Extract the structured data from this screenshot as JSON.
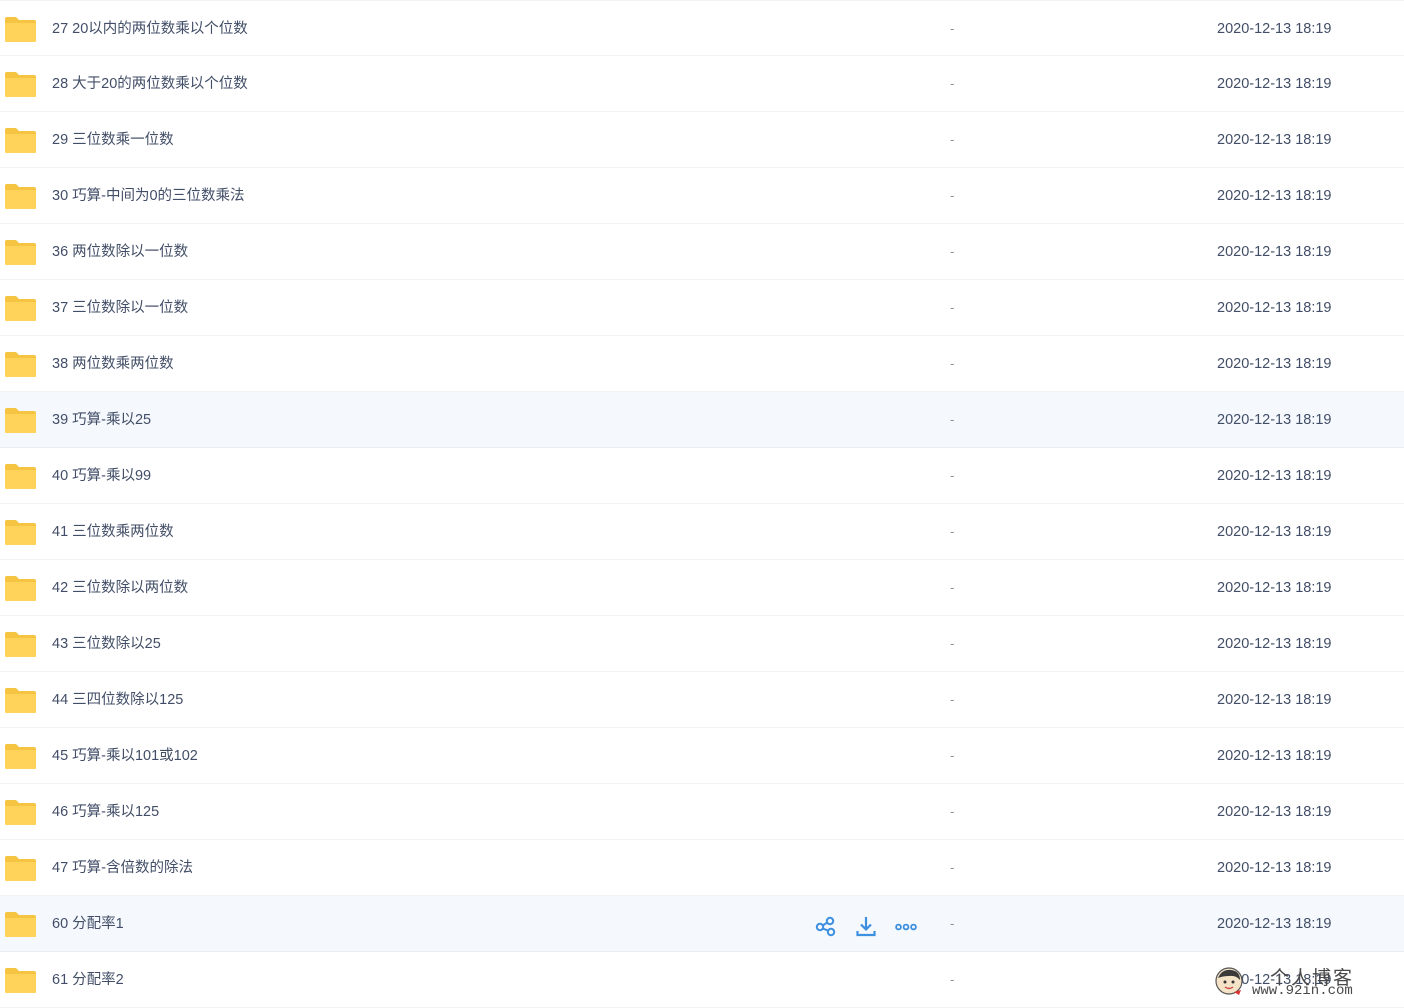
{
  "colors": {
    "folder": "#ffd35a",
    "folder_tab": "#f5c443",
    "action_icon": "#3d8fe0",
    "row_hover": "#f5f9fd",
    "text": "#424e67"
  },
  "icons": {
    "folder": "folder-icon",
    "share": "share-icon",
    "download": "download-icon",
    "more": "more-icon"
  },
  "files": [
    {
      "name": "27 20以内的两位数乘以个位数",
      "size": "-",
      "date": "2020-12-13 18:19"
    },
    {
      "name": "28 大于20的两位数乘以个位数",
      "size": "-",
      "date": "2020-12-13 18:19"
    },
    {
      "name": "29 三位数乘一位数",
      "size": "-",
      "date": "2020-12-13 18:19"
    },
    {
      "name": "30 巧算-中间为0的三位数乘法",
      "size": "-",
      "date": "2020-12-13 18:19"
    },
    {
      "name": "36 两位数除以一位数",
      "size": "-",
      "date": "2020-12-13 18:19"
    },
    {
      "name": "37 三位数除以一位数",
      "size": "-",
      "date": "2020-12-13 18:19"
    },
    {
      "name": "38 两位数乘两位数",
      "size": "-",
      "date": "2020-12-13 18:19"
    },
    {
      "name": "39 巧算-乘以25",
      "size": "-",
      "date": "2020-12-13 18:19"
    },
    {
      "name": "40 巧算-乘以99",
      "size": "-",
      "date": "2020-12-13 18:19"
    },
    {
      "name": "41 三位数乘两位数",
      "size": "-",
      "date": "2020-12-13 18:19"
    },
    {
      "name": "42 三位数除以两位数",
      "size": "-",
      "date": "2020-12-13 18:19"
    },
    {
      "name": "43 三位数除以25",
      "size": "-",
      "date": "2020-12-13 18:19"
    },
    {
      "name": "44 三四位数除以125",
      "size": "-",
      "date": "2020-12-13 18:19"
    },
    {
      "name": "45 巧算-乘以101或102",
      "size": "-",
      "date": "2020-12-13 18:19"
    },
    {
      "name": "46 巧算-乘以125",
      "size": "-",
      "date": "2020-12-13 18:19"
    },
    {
      "name": "47 巧算-含倍数的除法",
      "size": "-",
      "date": "2020-12-13 18:19"
    },
    {
      "name": "60 分配率1",
      "size": "-",
      "date": "2020-12-13 18:19"
    },
    {
      "name": "61 分配率2",
      "size": "-",
      "date": "2020-12-13 18:19"
    }
  ],
  "highlighted_rows": [
    7,
    16
  ],
  "hover_row": 16,
  "watermark": {
    "title": "个人博客",
    "url": "www.92in.com"
  }
}
